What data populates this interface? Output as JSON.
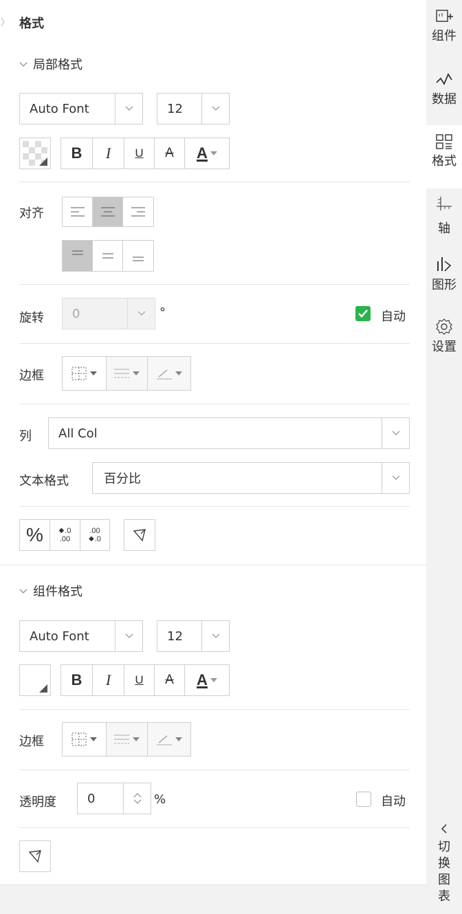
{
  "panel": {
    "title": "格式"
  },
  "local_format": {
    "section_title": "局部格式",
    "font": "Auto Font",
    "font_size": "12",
    "format_buttons": {
      "bold": "B",
      "italic": "I",
      "underline": "U",
      "strike": "A",
      "font_color": "A"
    },
    "align_label": "对齐",
    "rotate_label": "旋转",
    "rotate_value": "0",
    "degree_symbol": "°",
    "auto_label": "自动",
    "auto_checked": true,
    "border_label": "边框",
    "column_label": "列",
    "column_value": "All Col",
    "text_format_label": "文本格式",
    "text_format_value": "百分比",
    "percent_symbol": "%",
    "decimal_increase": {
      "top": ".0",
      "bottom": ".00"
    },
    "decimal_decrease": {
      "top": ".00",
      "bottom": ".0"
    }
  },
  "component_format": {
    "section_title": "组件格式",
    "font": "Auto Font",
    "font_size": "12",
    "format_buttons": {
      "bold": "B",
      "italic": "I",
      "underline": "U",
      "strike": "A",
      "font_color": "A"
    },
    "border_label": "边框",
    "opacity_label": "透明度",
    "opacity_value": "0",
    "opacity_unit": "%",
    "auto_label": "自动",
    "auto_checked": false
  },
  "sidebar": {
    "items": [
      {
        "label": "组件",
        "icon": "add-component-icon",
        "active": false
      },
      {
        "label": "数据",
        "icon": "data-line-icon",
        "active": false
      },
      {
        "label": "格式",
        "icon": "format-grid-icon",
        "active": true
      },
      {
        "label": "轴",
        "icon": "axis-icon",
        "active": false
      },
      {
        "label": "图形",
        "icon": "shape-chart-icon",
        "active": false
      },
      {
        "label": "设置",
        "icon": "gear-icon",
        "active": false
      }
    ],
    "switch_chart": {
      "chars": [
        "切",
        "换",
        "图",
        "表"
      ]
    }
  },
  "colors": {
    "accent_check": "#2bb24c",
    "active_segment": "#c7c7c7",
    "sidebar_bg": "#f2f2f2",
    "active_tab_bg": "#ffffff"
  }
}
